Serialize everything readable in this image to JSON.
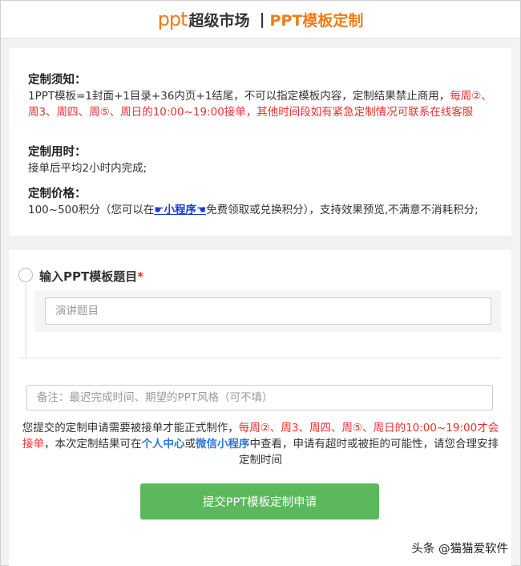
{
  "header": {
    "logo_ppt": "ppt",
    "logo_name": "超级市场",
    "separator": "|",
    "subtitle": "PPT模板定制"
  },
  "info": {
    "notice_title": "定制须知",
    "notice_text": "1PPT模板=1封面+1目录+36内页+1结尾，不可以指定模板内容，定制结果禁止商用，",
    "notice_red": "每周②、周3、周四、周⑤、周日的10:00~19:00接单，其他时间段如有紧急定制情况可联系在线客服",
    "time_title": "定制用时",
    "time_text": "接单后平均2小时内完成;",
    "price_title": "定制价格",
    "price_text_1": "100~500积分（您可以在",
    "price_link": "☛小程序☚",
    "price_text_2": "免费领取或兑换积分），支持效果预览,不满意不消耗积分;"
  },
  "form": {
    "question_label": "输入PPT模板题目",
    "required_mark": "*",
    "topic_placeholder": "演讲题目",
    "remark_placeholder": "备注：最迟完成时间、期望的PPT风格（可不填）",
    "notice_1": "您提交的定制申请需要被接单才能正式制作，",
    "notice_red": "每周②、周3、周四、周⑤、周日的10:00~19:00才会接单",
    "notice_2": "，本次定制结果可在",
    "notice_link1": "个人中心",
    "notice_or": "或",
    "notice_link2": "微信小程序",
    "notice_3": "中查看，申请有超时或被拒的可能性，请您合理安排定制时间",
    "submit_label": "提交PPT模板定制申请"
  },
  "watermark": "头条 @猫猫爱软件",
  "colors": {
    "brand_orange": "#f07c1a",
    "alert_red": "#e8312f",
    "link_blue": "#2a7ad4",
    "submit_green": "#5cb85c"
  }
}
